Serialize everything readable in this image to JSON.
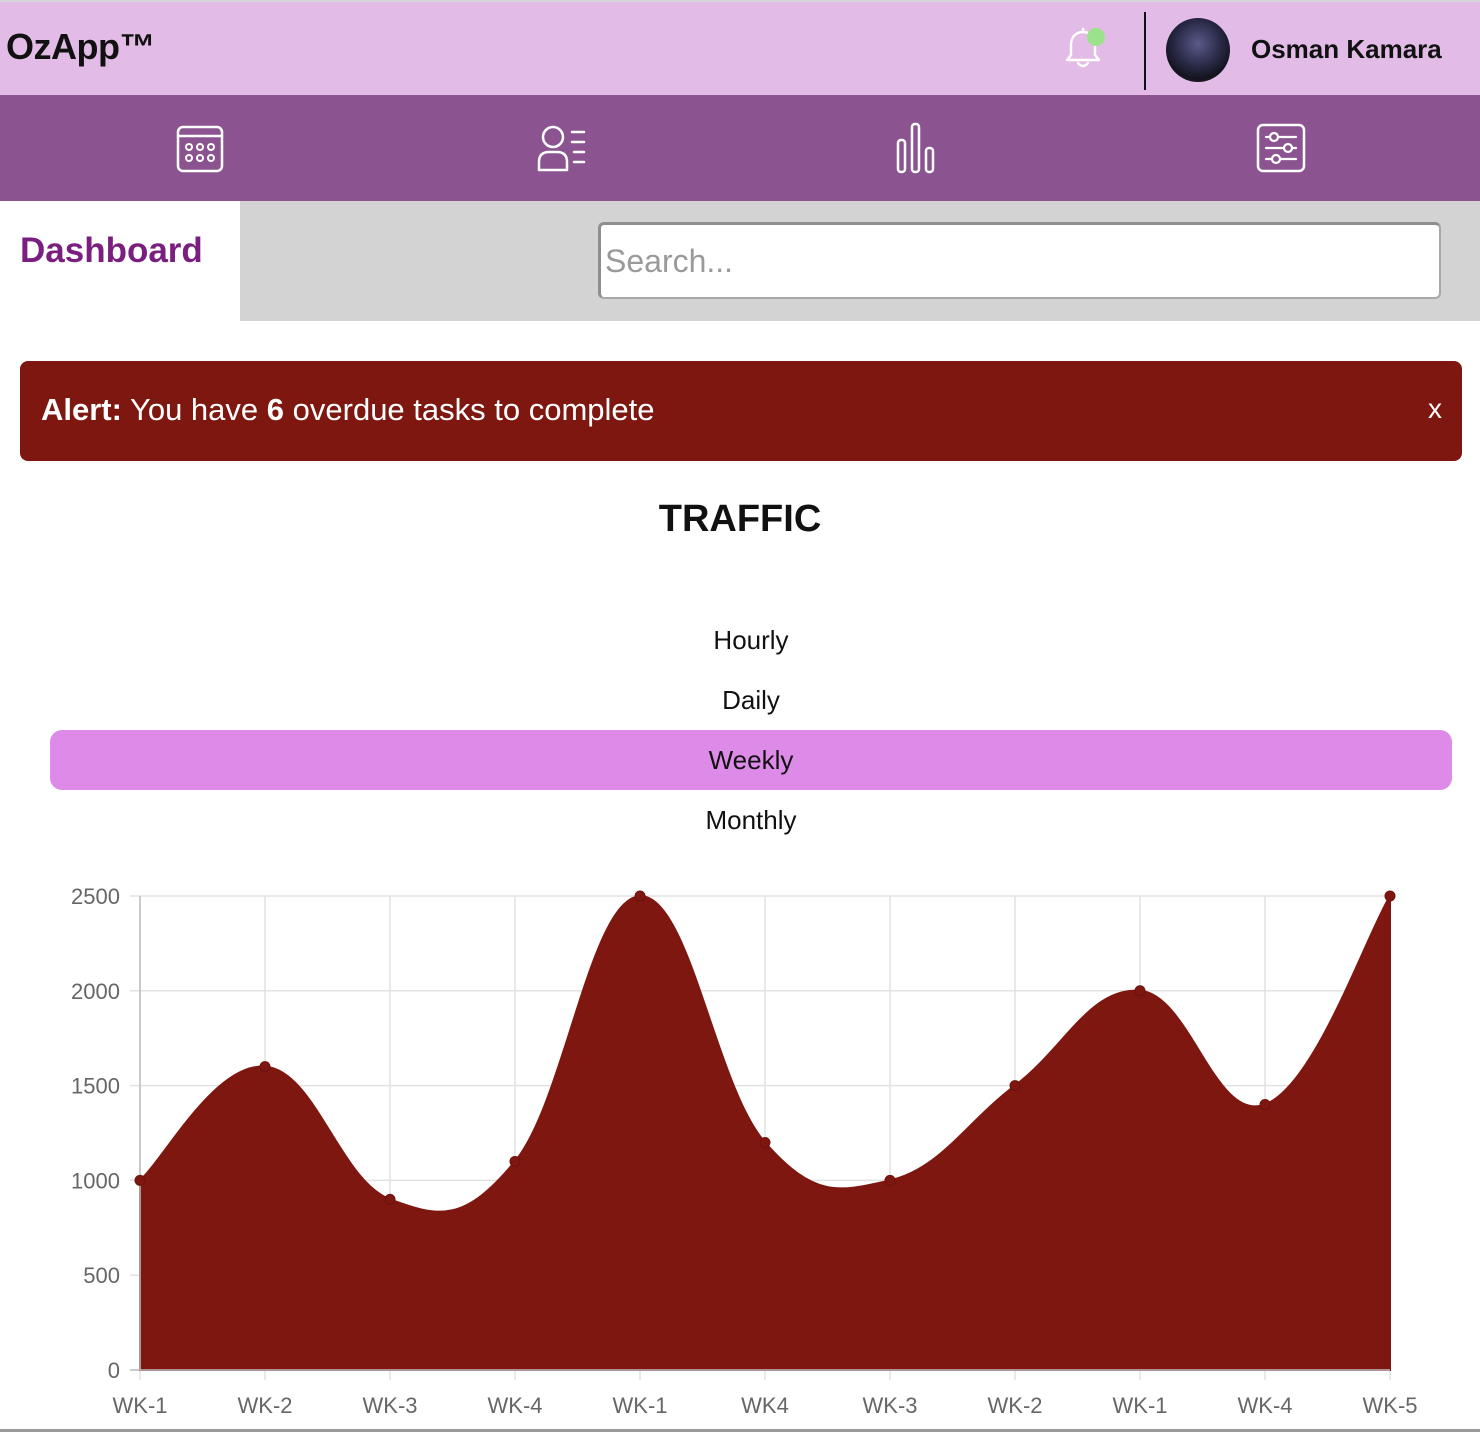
{
  "app": {
    "title": "OzApp™"
  },
  "header": {
    "notification_icon": "bell-icon",
    "notification_dot_color": "#9be38a",
    "user_name": "Osman Kamara"
  },
  "nav": {
    "items": [
      {
        "icon": "calendar-icon"
      },
      {
        "icon": "user-list-icon"
      },
      {
        "icon": "bar-chart-icon"
      },
      {
        "icon": "settings-sliders-icon"
      }
    ]
  },
  "page": {
    "title": "Dashboard"
  },
  "search": {
    "placeholder": "Search..."
  },
  "alert": {
    "label": "Alert:",
    "text_before": " You have ",
    "count": "6",
    "text_after": " overdue tasks to complete",
    "close_label": "x",
    "color": "#7e1710"
  },
  "traffic": {
    "title": "TRAFFIC",
    "periods": [
      "Hourly",
      "Daily",
      "Weekly",
      "Monthly"
    ],
    "active_period": "Weekly",
    "active_color": "#de8ae8"
  },
  "chart_data": {
    "type": "area",
    "title": "",
    "xlabel": "",
    "ylabel": "",
    "categories": [
      "WK-1",
      "WK-2",
      "WK-3",
      "WK-4",
      "WK-1",
      "WK4",
      "WK-3",
      "WK-2",
      "WK-1",
      "WK-4",
      "WK-5"
    ],
    "values": [
      1000,
      1600,
      900,
      1100,
      2500,
      1200,
      1000,
      1500,
      2000,
      1400,
      2500
    ],
    "ylim": [
      0,
      2500
    ],
    "yticks": [
      0,
      500,
      1000,
      1500,
      2000,
      2500
    ],
    "grid": true,
    "fill_color": "#7e1710"
  }
}
